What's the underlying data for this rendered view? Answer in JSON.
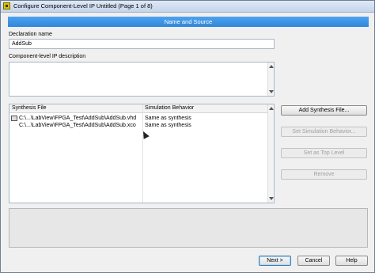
{
  "window": {
    "title": "Configure Component-Level IP Untitled (Page 1 of 8)"
  },
  "banner": {
    "text": "Name and Source"
  },
  "declaration": {
    "label": "Declaration name",
    "value": "AddSub"
  },
  "description": {
    "label": "Component-level IP description",
    "value": ""
  },
  "files_table": {
    "headers": [
      "Synthesis File",
      "Simulation Behavior"
    ],
    "rows": [
      {
        "file": "C:\\...\\LabView\\FPGA_Test\\AddSub\\AddSub.vhd",
        "behavior": "Same as synthesis",
        "icon": "file-icon"
      },
      {
        "file": "C:\\...\\LabView\\FPGA_Test\\AddSub\\AddSub.xco",
        "behavior": "Same as synthesis",
        "icon": ""
      }
    ]
  },
  "side_buttons": {
    "add": "Add Synthesis File...",
    "set_sim": "Set Simulation Behavior...",
    "set_top": "Set as Top Level",
    "remove": "Remove"
  },
  "footer": {
    "next": "Next >",
    "cancel": "Cancel",
    "help": "Help"
  },
  "colors": {
    "banner": "#3a90e2",
    "window_bg": "#f0f0f0"
  }
}
